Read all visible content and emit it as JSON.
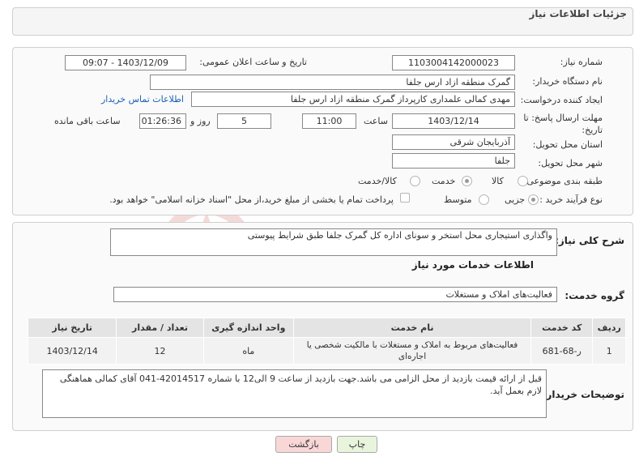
{
  "header": {
    "title": "جزئیات اطلاعات نیاز"
  },
  "form": {
    "need_number_label": "شماره نیاز:",
    "need_number_value": "1103004142000023",
    "announce_label": "تاریخ و ساعت اعلان عمومی:",
    "announce_value": "1403/12/09 - 09:07",
    "buyer_org_label": "نام دستگاه خریدار:",
    "buyer_org_value": "گمرک منطقه ازاد ارس جلفا",
    "requester_label": "ایجاد کننده درخواست:",
    "requester_value": "مهدی کمالی علمداری کارپرداز گمرک منطقه ازاد ارس جلفا",
    "buyer_contact_link": "اطلاعات تماس خریدار",
    "deadline_label_1": "مهلت ارسال پاسخ: تا",
    "deadline_label_2": "تاریخ:",
    "deadline_date": "1403/12/14",
    "time_label": "ساعت",
    "deadline_time": "11:00",
    "days_value": "5",
    "days_label": "روز و",
    "remaining_time": "01:26:36",
    "remaining_label": "ساعت باقی مانده",
    "province_label": "استان محل تحویل:",
    "province_value": "آذربایجان شرقی",
    "city_label": "شهر محل تحویل:",
    "city_value": "جلفا",
    "category_label": "طبقه بندی موضوعی:",
    "category_options": [
      "کالا",
      "خدمت",
      "کالا/خدمت"
    ],
    "category_selected": "خدمت",
    "process_label": "نوع فرآیند خرید :",
    "process_options": [
      "جزیی",
      "متوسط"
    ],
    "process_selected": "جزیی",
    "payment_note": "پرداخت تمام یا بخشی از مبلغ خرید،از محل \"اسناد خزانه اسلامی\" خواهد بود."
  },
  "details": {
    "general_desc_label": "شرح کلی نیاز:",
    "general_desc_value": "واگذاری استیجاری محل استخر و سونای اداره کل گمرک جلفا طبق شرایط پیوستی",
    "services_title": "اطلاعات خدمات مورد نیاز",
    "service_group_label": "گروه خدمت:",
    "service_group_value": "فعالیت‌های  املاک و مستغلات",
    "table": {
      "headers": [
        "ردیف",
        "کد خدمت",
        "نام خدمت",
        "واحد اندازه گیری",
        "تعداد / مقدار",
        "تاریخ نیاز"
      ],
      "rows": [
        [
          "1",
          "ر-68-681",
          "فعالیت‌های مربوط به املاک و مستغلات با مالکیت شخصی یا اجاره‌ای",
          "ماه",
          "12",
          "1403/12/14"
        ]
      ]
    },
    "buyer_notes_label": "توضیحات خریدار:",
    "buyer_notes_value": "قبل از ارائه قیمت بازدید از محل الزامی  می باشد.جهت بازدید از ساعت 9 الی12 با شماره 42014517-041 آقای کمالی هماهنگی لازم بعمل آید."
  },
  "buttons": {
    "print": "چاپ",
    "back": "بازگشت"
  },
  "colors": {
    "back_button_bg": "#f9d7d7",
    "print_button_bg": "#e8f5dc",
    "link": "#1a5fb4"
  }
}
